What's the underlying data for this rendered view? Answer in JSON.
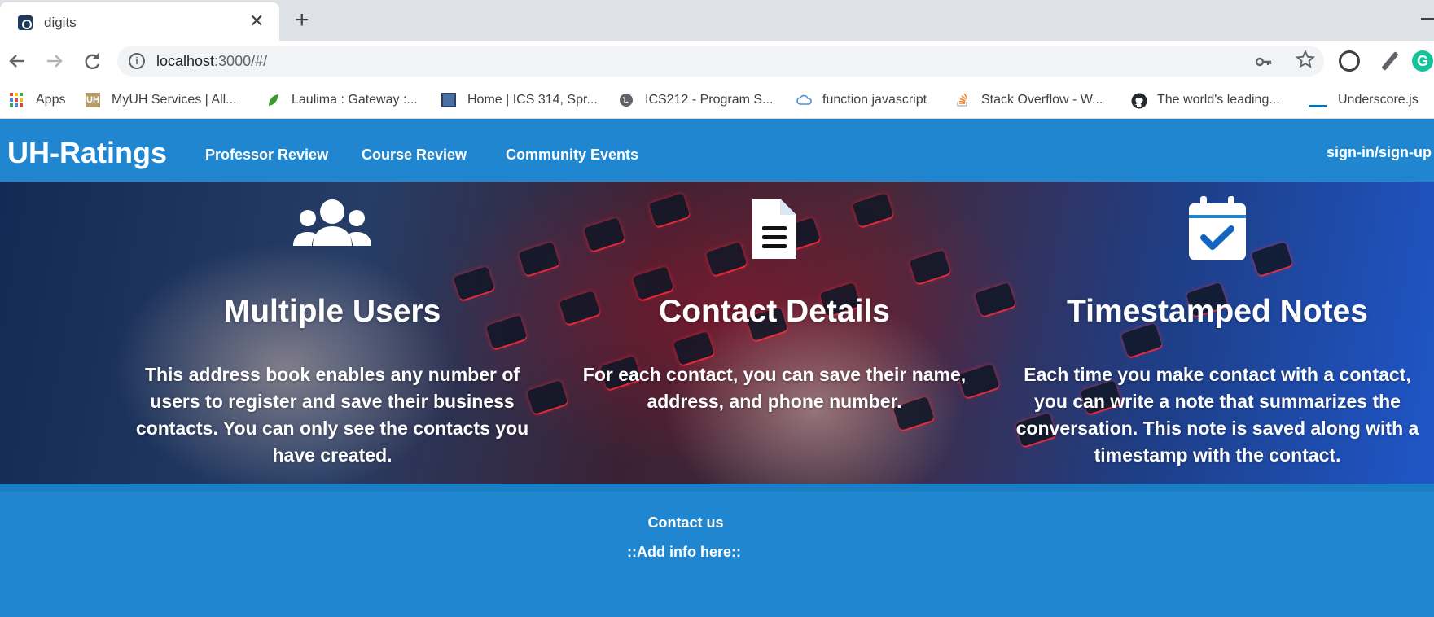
{
  "browser": {
    "tab_title": "digits",
    "tab_close": "✕",
    "new_tab": "+",
    "url_host": "localhost",
    "url_rest": ":3000/#/",
    "bookmarks": [
      {
        "label": "Apps",
        "icon": "apps-grid-icon"
      },
      {
        "label": "MyUH Services | All...",
        "icon": "myuh-icon"
      },
      {
        "label": "Laulima : Gateway :...",
        "icon": "laulima-leaf-icon"
      },
      {
        "label": "Home | ICS 314, Spr...",
        "icon": "ics314-icon"
      },
      {
        "label": "ICS212 - Program S...",
        "icon": "globe-icon"
      },
      {
        "label": "function javascript",
        "icon": "cloud-icon"
      },
      {
        "label": "Stack Overflow - W...",
        "icon": "stackoverflow-icon"
      },
      {
        "label": "The world's leading...",
        "icon": "github-icon"
      },
      {
        "label": "Underscore.js",
        "icon": "underscore-icon"
      }
    ]
  },
  "navbar": {
    "brand": "UH-Ratings",
    "links": [
      "Professor Review",
      "Course Review",
      "Community Events"
    ],
    "signin": "sign-in/sign-up"
  },
  "features": [
    {
      "icon": "users-icon",
      "title": "Multiple Users",
      "text": "This address book enables any number of users to register and save their business contacts. You can only see the contacts you have created."
    },
    {
      "icon": "document-icon",
      "title": "Contact Details",
      "text": "For each contact, you can save their name, address, and phone number."
    },
    {
      "icon": "calendar-check-icon",
      "title": "Timestamped Notes",
      "text": "Each time you make contact with a contact, you can write a note that summarizes the conversation. This note is saved along with a timestamp with the contact."
    }
  ],
  "footer": {
    "contact": "Contact us",
    "info": "::Add info here::"
  },
  "colors": {
    "primary": "#2186d0",
    "white": "#ffffff"
  }
}
